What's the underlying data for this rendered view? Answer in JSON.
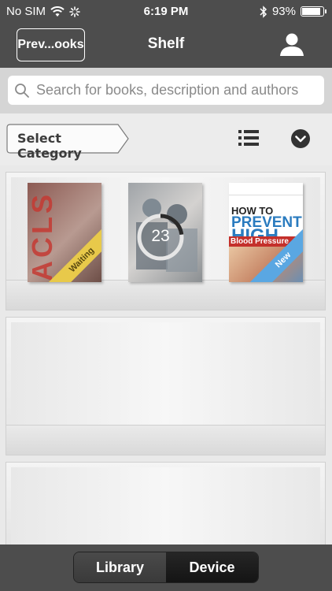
{
  "status_bar": {
    "carrier": "No SIM",
    "time": "6:19 PM",
    "battery_percent": "93%",
    "battery_level": 0.93,
    "icons": [
      "wifi-icon",
      "activity-spinner-icon",
      "bluetooth-icon",
      "battery-icon"
    ]
  },
  "nav": {
    "back_label": "Prev...ooks",
    "title": "Shelf",
    "profile_icon": "person-icon"
  },
  "search": {
    "placeholder": "Search for books, description and authors",
    "icon": "search-icon"
  },
  "toolbar": {
    "category_label": "Select Category",
    "list_icon": "list-view-icon",
    "dropdown_icon": "chevron-down-circle-icon"
  },
  "shelves": [
    {
      "books": [
        {
          "cover_text": "ACLS",
          "badge": "Waiting",
          "badge_color": "#e8c94a"
        },
        {
          "progress_label": "23",
          "progress": 0.23
        },
        {
          "cover_lines": [
            "HOW TO",
            "PREVENT",
            "HIGH",
            "Blood Pressure"
          ],
          "badge": "New",
          "badge_color": "#5aa7e2"
        }
      ]
    },
    {
      "books": []
    },
    {
      "books": []
    }
  ],
  "tabs": {
    "library_label": "Library",
    "device_label": "Device",
    "active": "Library"
  },
  "colors": {
    "bar_background": "#4d4d4d",
    "search_background": "#d5d5d5",
    "page_background": "#ececec"
  }
}
